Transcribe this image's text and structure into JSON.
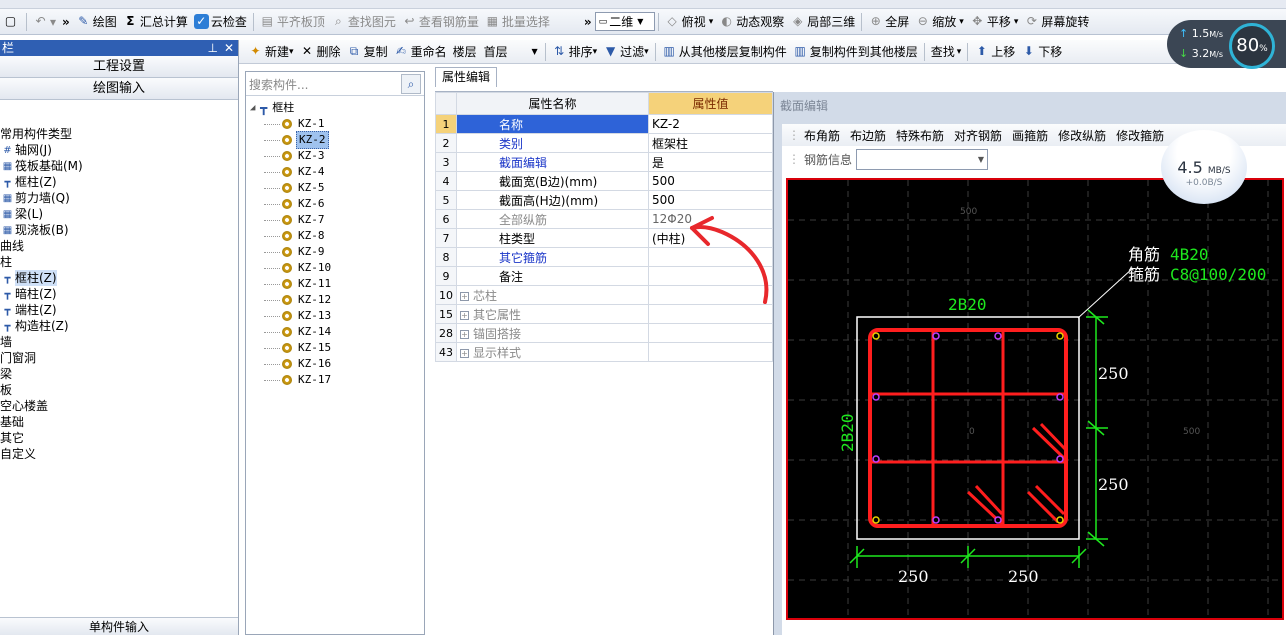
{
  "toolbar_main": {
    "items": [
      {
        "label": "绘图",
        "icon": "draw-icon"
      },
      {
        "label": "汇总计算",
        "icon": "sigma-icon"
      },
      {
        "label": "云检查",
        "icon": "cloud-check-icon"
      },
      {
        "label": "平齐板顶",
        "icon": "align-icon",
        "disabled": true
      },
      {
        "label": "查找图元",
        "icon": "find-icon",
        "disabled": true
      },
      {
        "label": "查看钢筋量",
        "icon": "rebar-qty-icon",
        "disabled": true
      },
      {
        "label": "批量选择",
        "icon": "batch-select-icon",
        "disabled": true
      },
      {
        "label": "二维",
        "icon": "view-2d-icon"
      },
      {
        "label": "俯视",
        "icon": "top-view-icon"
      },
      {
        "label": "动态观察",
        "icon": "orbit-icon"
      },
      {
        "label": "局部三维",
        "icon": "local-3d-icon"
      },
      {
        "label": "全屏",
        "icon": "fullscreen-icon"
      },
      {
        "label": "缩放",
        "icon": "zoom-icon"
      },
      {
        "label": "平移",
        "icon": "pan-icon"
      },
      {
        "label": "屏幕旋转",
        "icon": "rotate-icon"
      }
    ]
  },
  "left_panel": {
    "title": "栏",
    "sections": [
      "工程设置",
      "绘图输入"
    ],
    "tree": [
      {
        "label": "常用构件类型",
        "indent": 0
      },
      {
        "label": "轴网(J)",
        "indent": 1,
        "icon": "axis-grid-icon"
      },
      {
        "label": "筏板基础(M)",
        "indent": 1,
        "icon": "raft-icon"
      },
      {
        "label": "框柱(Z)",
        "indent": 1,
        "icon": "column-icon"
      },
      {
        "label": "剪力墙(Q)",
        "indent": 1,
        "icon": "wall-icon"
      },
      {
        "label": "梁(L)",
        "indent": 1,
        "icon": "beam-icon"
      },
      {
        "label": "现浇板(B)",
        "indent": 1,
        "icon": "slab-icon"
      },
      {
        "label": "曲线",
        "indent": 0
      },
      {
        "label": "柱",
        "indent": 0
      },
      {
        "label": "框柱(Z)",
        "indent": 1,
        "icon": "column-icon",
        "selected": true
      },
      {
        "label": "暗柱(Z)",
        "indent": 1,
        "icon": "column-icon"
      },
      {
        "label": "端柱(Z)",
        "indent": 1,
        "icon": "column-icon"
      },
      {
        "label": "构造柱(Z)",
        "indent": 1,
        "icon": "column-icon"
      },
      {
        "label": "墙",
        "indent": 0
      },
      {
        "label": "门窗洞",
        "indent": 0
      },
      {
        "label": "梁",
        "indent": 0
      },
      {
        "label": "板",
        "indent": 0
      },
      {
        "label": "空心楼盖",
        "indent": 0
      },
      {
        "label": "基础",
        "indent": 0
      },
      {
        "label": "其它",
        "indent": 0
      },
      {
        "label": "自定义",
        "indent": 0
      }
    ],
    "bottom": "单构件输入"
  },
  "toolbar_edit": {
    "new": "新建",
    "delete": "删除",
    "copy": "复制",
    "rename": "重命名",
    "floor_label": "楼层",
    "floor_value": "首层",
    "sort": "排序",
    "filter": "过滤",
    "copy_from": "从其他楼层复制构件",
    "copy_to": "复制构件到其他楼层",
    "find": "查找",
    "up": "上移",
    "down": "下移"
  },
  "component_tree": {
    "search_placeholder": "搜索构件...",
    "root": "框柱",
    "items": [
      "KZ-1",
      "KZ-2",
      "KZ-3",
      "KZ-4",
      "KZ-5",
      "KZ-6",
      "KZ-7",
      "KZ-8",
      "KZ-9",
      "KZ-10",
      "KZ-11",
      "KZ-12",
      "KZ-13",
      "KZ-14",
      "KZ-15",
      "KZ-16",
      "KZ-17"
    ],
    "selected_index": 1
  },
  "property_editor": {
    "tab": "属性编辑",
    "col_name": "属性名称",
    "col_value": "属性值",
    "rows": [
      {
        "no": "1",
        "name": "名称",
        "value": "KZ-2",
        "style": "blue",
        "selected": true
      },
      {
        "no": "2",
        "name": "类别",
        "value": "框架柱",
        "style": "blue"
      },
      {
        "no": "3",
        "name": "截面编辑",
        "value": "是",
        "style": "blue"
      },
      {
        "no": "4",
        "name": "截面宽(B边)(mm)",
        "value": "500",
        "style": "normal"
      },
      {
        "no": "5",
        "name": "截面高(H边)(mm)",
        "value": "500",
        "style": "normal"
      },
      {
        "no": "6",
        "name": "全部纵筋",
        "value": "12Φ20",
        "style": "gray"
      },
      {
        "no": "7",
        "name": "柱类型",
        "value": "(中柱)",
        "style": "normal"
      },
      {
        "no": "8",
        "name": "其它箍筋",
        "value": "",
        "style": "blue"
      },
      {
        "no": "9",
        "name": "备注",
        "value": "",
        "style": "normal"
      },
      {
        "no": "10",
        "name": "芯柱",
        "value": "",
        "style": "group"
      },
      {
        "no": "15",
        "name": "其它属性",
        "value": "",
        "style": "group"
      },
      {
        "no": "28",
        "name": "锚固搭接",
        "value": "",
        "style": "group"
      },
      {
        "no": "43",
        "name": "显示样式",
        "value": "",
        "style": "group"
      }
    ]
  },
  "section_editor": {
    "title": "截面编辑",
    "tools": [
      "布角筋",
      "布边筋",
      "特殊布筋",
      "对齐钢筋",
      "画箍筋",
      "修改纵筋",
      "修改箍筋"
    ],
    "rebar_info_label": "钢筋信息",
    "canvas": {
      "tick_labels": {
        "top": "500",
        "center": "0",
        "right": "500"
      },
      "corner_label": "角筋",
      "corner_value": "4B20",
      "stirrup_label": "箍筋",
      "stirrup_value": "C8@100/200",
      "top_side": "2B20",
      "left_side": "2B20",
      "dim_right_top": "250",
      "dim_right_bottom": "250",
      "dim_bottom_left": "250",
      "dim_bottom_right": "250"
    }
  },
  "net_badge": {
    "upload": "1.5",
    "upload_unit": "M/s",
    "download": "3.2",
    "download_unit": "M/s",
    "percent": "80",
    "percent_unit": "%"
  },
  "speed_bubble": {
    "value": "4.5",
    "unit": "MB/S",
    "sub": "+0.0B/S"
  },
  "colors": {
    "selection_blue": "#2e63d8",
    "header_gold": "#f5d27a",
    "rebar_red": "#ff1e1e",
    "dimension_green": "#1ee81e",
    "annotation_red": "#e8282c"
  }
}
